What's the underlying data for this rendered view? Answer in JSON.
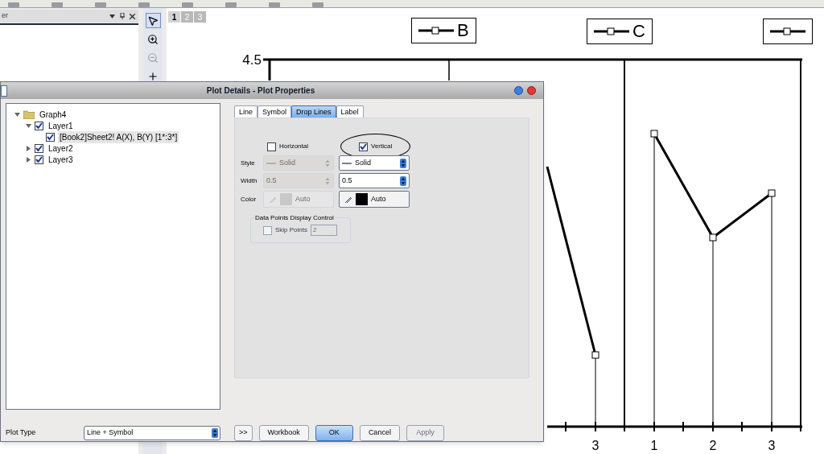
{
  "explorer": {
    "title": "er"
  },
  "page_tabs": [
    {
      "label": "1",
      "selected": true
    },
    {
      "label": "2",
      "selected": false
    },
    {
      "label": "3",
      "selected": false
    }
  ],
  "tools": [
    {
      "kind": "pointer",
      "selected": true
    },
    {
      "kind": "zoom_in",
      "selected": false
    },
    {
      "kind": "zoom_out",
      "selected": false
    },
    {
      "kind": "crosshair",
      "selected": false
    }
  ],
  "graph": {
    "y_tick_label": "4.5",
    "legend": [
      {
        "label": "B"
      },
      {
        "label": "C"
      },
      {
        "cut": true
      }
    ],
    "x_tick_labels": [
      "3",
      "1",
      "2",
      "3"
    ]
  },
  "dialog": {
    "title": "Plot Details - Plot Properties",
    "tree": [
      {
        "label": "Graph4",
        "expanded": true,
        "children": [
          {
            "label": "Layer1",
            "checked": true,
            "expanded": true,
            "children": [
              {
                "label": "[Book2]Sheet2! A(X), B(Y) [1*:3*]",
                "checked": true,
                "selected": true
              }
            ]
          },
          {
            "label": "Layer2",
            "checked": true,
            "expanded": false
          },
          {
            "label": "Layer3",
            "checked": true,
            "expanded": false
          }
        ]
      }
    ],
    "tabs": [
      {
        "label": "Line",
        "selected": false
      },
      {
        "label": "Symbol",
        "selected": false
      },
      {
        "label": "Drop Lines",
        "selected": true
      },
      {
        "label": "Label",
        "selected": false
      }
    ],
    "checks": [
      {
        "label": "Horizontal",
        "checked": false,
        "highlighted": false
      },
      {
        "label": "Vertical",
        "checked": true,
        "highlighted": true
      }
    ],
    "rows": [
      {
        "label": "Style",
        "kind": "line_select",
        "left": {
          "value": "Solid",
          "disabled": true
        },
        "right": {
          "value": "Solid",
          "disabled": false
        }
      },
      {
        "label": "Width",
        "kind": "spin",
        "left": {
          "value": "0.5",
          "disabled": true
        },
        "right": {
          "value": "0.5",
          "disabled": false
        }
      },
      {
        "label": "Color",
        "kind": "color",
        "left": {
          "value": "Auto",
          "disabled": true
        },
        "right": {
          "value": "Auto",
          "disabled": false
        }
      }
    ],
    "group": {
      "title": "Data Points Display Control",
      "label": "Skip Points",
      "checked": false,
      "disabled": true,
      "value": "2"
    },
    "plot_type": {
      "label": "Plot Type",
      "value": "Line + Symbol"
    },
    "buttons": [
      {
        "label": ">>",
        "default": false,
        "disabled": false
      },
      {
        "label": "Workbook",
        "default": false,
        "disabled": false
      },
      {
        "label": "OK",
        "default": true,
        "disabled": false
      },
      {
        "label": "Cancel",
        "default": false,
        "disabled": false
      },
      {
        "label": "Apply",
        "default": false,
        "disabled": true
      }
    ]
  }
}
